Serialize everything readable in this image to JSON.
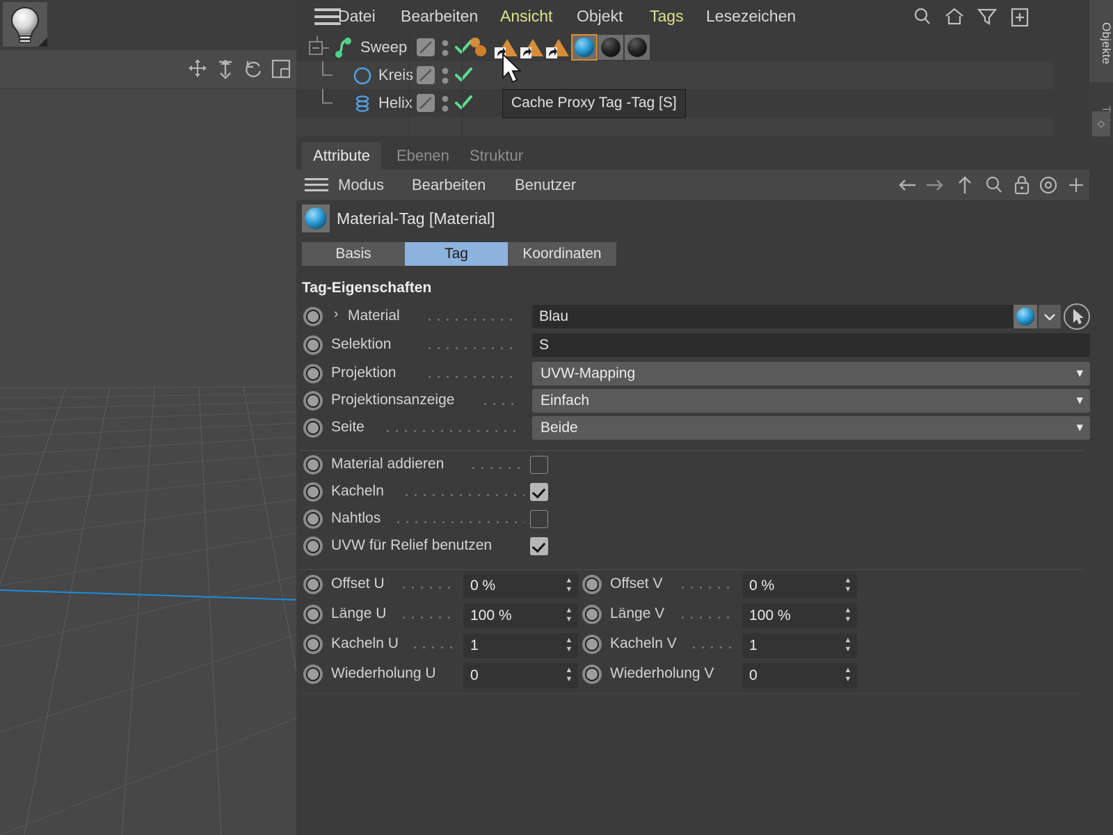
{
  "app": {
    "accent_blue": "#8db2de",
    "accent_orange": "#e08b2a",
    "highlight_yellow": "#dde58c",
    "panel_bg": "#3b3b3b",
    "viewport_bg": "#474747",
    "axis_line_color": "#1a8fe0"
  },
  "viewport": {
    "light_tool_icon": "lightbulb-icon",
    "icons": [
      {
        "name": "move-icon",
        "label": "Verschieben"
      },
      {
        "name": "scale-icon",
        "label": "Skalieren"
      },
      {
        "name": "rotate-icon",
        "label": "Drehen"
      },
      {
        "name": "layout-icon",
        "label": "Ansichtslayout"
      }
    ]
  },
  "menubar": {
    "hamburger": "hamburger-icon",
    "items": [
      {
        "label": "Datei",
        "highlight": false
      },
      {
        "label": "Bearbeiten",
        "highlight": false
      },
      {
        "label": "Ansicht",
        "highlight": true
      },
      {
        "label": "Objekt",
        "highlight": false
      },
      {
        "label": "Tags",
        "highlight": true
      },
      {
        "label": "Lesezeichen",
        "highlight": false
      }
    ],
    "icons": [
      {
        "name": "search-icon"
      },
      {
        "name": "home-icon"
      },
      {
        "name": "filter-icon"
      },
      {
        "name": "add-icon"
      }
    ]
  },
  "vertical_tabs": [
    {
      "label": "Objekte",
      "active": true
    },
    {
      "label": "Tak",
      "active": false
    }
  ],
  "object_manager": {
    "rows": [
      {
        "name": "Sweep",
        "icon": "sweep-icon",
        "indent": 0,
        "expander": "minus",
        "visible_dots": true,
        "enabled_check": true,
        "tags": [
          {
            "name": "sds-weight-tag",
            "type": "spheres"
          },
          {
            "name": "cache-proxy-tag",
            "type": "orange-triangle",
            "selected": false
          },
          {
            "name": "cache-proxy-tag",
            "type": "orange-triangle",
            "selected": false
          },
          {
            "name": "cache-proxy-tag",
            "type": "orange-triangle",
            "selected": false
          },
          {
            "name": "material-tag-blue",
            "type": "material-blue",
            "selected": true
          },
          {
            "name": "material-tag-dark-1",
            "type": "material-dark",
            "selected": false
          },
          {
            "name": "material-tag-dark-2",
            "type": "material-dark",
            "selected": false
          }
        ]
      },
      {
        "name": "Kreis",
        "icon": "circle-spline-icon",
        "indent": 1,
        "expander": "none",
        "visible_dots": true,
        "enabled_check": true,
        "tags": []
      },
      {
        "name": "Helix",
        "icon": "helix-spline-icon",
        "indent": 1,
        "expander": "none",
        "visible_dots": true,
        "enabled_check": true,
        "tags": []
      }
    ],
    "tooltip": "Cache Proxy Tag -Tag [S]",
    "cursor": "arrow-cursor"
  },
  "attribute_manager": {
    "tabs": [
      {
        "label": "Attribute",
        "active": true
      },
      {
        "label": "Ebenen",
        "active": false
      },
      {
        "label": "Struktur",
        "active": false
      }
    ],
    "toolbar": {
      "hamburger": "hamburger-icon",
      "menus": [
        {
          "label": "Modus"
        },
        {
          "label": "Bearbeiten"
        },
        {
          "label": "Benutzer"
        }
      ],
      "icons": [
        {
          "name": "back-arrow-icon"
        },
        {
          "name": "forward-arrow-icon"
        },
        {
          "name": "up-arrow-icon"
        },
        {
          "name": "search-icon"
        },
        {
          "name": "lock-icon"
        },
        {
          "name": "target-icon"
        },
        {
          "name": "add-icon"
        }
      ]
    },
    "object_header": {
      "icon": "material-tag-icon",
      "title": "Material-Tag [Material]"
    },
    "sub_tabs": [
      {
        "label": "Basis",
        "active": false
      },
      {
        "label": "Tag",
        "active": true
      },
      {
        "label": "Koordinaten",
        "active": false
      }
    ],
    "section_title": "Tag-Eigenschaften",
    "properties": [
      {
        "id": "material",
        "label": "Material",
        "widget": "material-link",
        "has_expander": true,
        "value": "Blau",
        "swatch": "material-blue-sphere",
        "dropdown_icon": "chevron-down-icon",
        "picker_icon": "pick-arrow-icon"
      },
      {
        "id": "selektion",
        "label": "Selektion",
        "widget": "text",
        "value": "S"
      },
      {
        "id": "projektion",
        "label": "Projektion",
        "widget": "combo",
        "value": "UVW-Mapping"
      },
      {
        "id": "projektionsanzeige",
        "label": "Projektionsanzeige",
        "widget": "combo",
        "value": "Einfach"
      },
      {
        "id": "seite",
        "label": "Seite",
        "widget": "combo",
        "value": "Beide"
      }
    ],
    "checkboxes": [
      {
        "id": "material-addieren",
        "label": "Material addieren",
        "checked": false
      },
      {
        "id": "kacheln",
        "label": "Kacheln",
        "checked": true
      },
      {
        "id": "nahtlos",
        "label": "Nahtlos",
        "checked": false
      },
      {
        "id": "uvw-fuer-relief-benutzen",
        "label": "UVW für Relief benutzen",
        "checked": true
      }
    ],
    "numeric_rows": [
      {
        "left": {
          "id": "offset-u",
          "label": "Offset U",
          "value": "0 %"
        },
        "right": {
          "id": "offset-v",
          "label": "Offset V",
          "value": "0 %"
        }
      },
      {
        "left": {
          "id": "laenge-u",
          "label": "Länge U",
          "value": "100 %"
        },
        "right": {
          "id": "laenge-v",
          "label": "Länge V",
          "value": "100 %"
        }
      },
      {
        "left": {
          "id": "kacheln-u",
          "label": "Kacheln U",
          "value": "1"
        },
        "right": {
          "id": "kacheln-v",
          "label": "Kacheln V",
          "value": "1"
        }
      },
      {
        "left": {
          "id": "wiederholung-u",
          "label": "Wiederholung U",
          "value": "0"
        },
        "right": {
          "id": "wiederholung-v",
          "label": "Wiederholung V",
          "value": "0"
        }
      }
    ]
  }
}
